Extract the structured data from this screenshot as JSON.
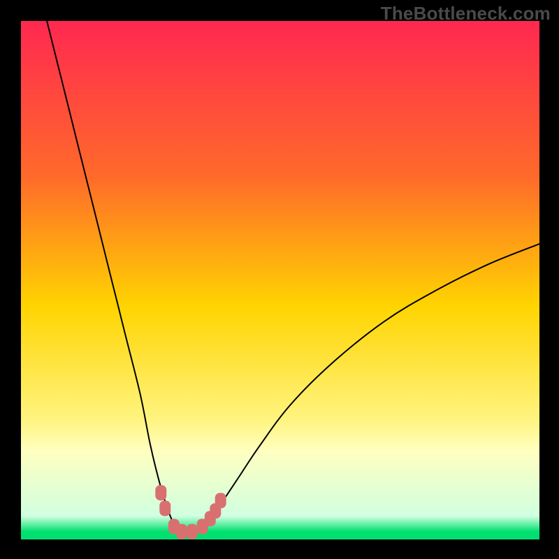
{
  "watermark": "TheBottleneck.com",
  "chart_data": {
    "type": "line",
    "title": "",
    "xlabel": "",
    "ylabel": "",
    "xlim": [
      0,
      100
    ],
    "ylim": [
      0,
      100
    ],
    "background_gradient": [
      {
        "stop": 0.0,
        "color": "#ff2850"
      },
      {
        "stop": 0.3,
        "color": "#ff6a2a"
      },
      {
        "stop": 0.55,
        "color": "#ffd400"
      },
      {
        "stop": 0.77,
        "color": "#fff480"
      },
      {
        "stop": 0.83,
        "color": "#ffffc0"
      },
      {
        "stop": 0.955,
        "color": "#d0ffe0"
      },
      {
        "stop": 0.985,
        "color": "#00e070"
      }
    ],
    "series": [
      {
        "name": "bottleneck-curve",
        "x": [
          5,
          8,
          11,
          14,
          17,
          20,
          23,
          25,
          27,
          29,
          30.5,
          33,
          36,
          38,
          42,
          46,
          52,
          60,
          70,
          80,
          90,
          100
        ],
        "values": [
          100,
          88,
          76,
          64,
          52,
          40,
          28,
          18,
          10,
          4,
          1.5,
          1.5,
          3,
          6,
          12,
          18,
          26,
          34,
          42,
          48,
          53,
          57
        ]
      }
    ],
    "markers": {
      "name": "highlighted-points",
      "color": "#d97070",
      "x": [
        27,
        27.8,
        29.5,
        31,
        33,
        35,
        36.5,
        37.5,
        38.5
      ],
      "values": [
        9,
        6,
        2.5,
        1.5,
        1.5,
        2.5,
        4,
        5.5,
        7.5
      ]
    },
    "bottom_green_band_fraction": 0.015
  }
}
